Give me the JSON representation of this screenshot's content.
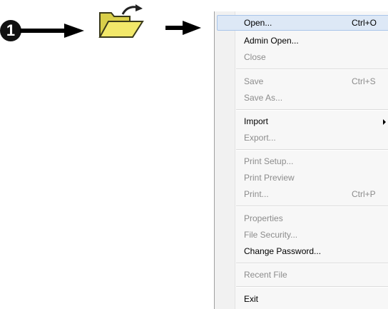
{
  "step": {
    "number": "1"
  },
  "icons": {
    "folder": "open-folder-icon",
    "arrow": "right-arrow-icon"
  },
  "menu": {
    "items": [
      {
        "label": "Open...",
        "shortcut": "Ctrl+O",
        "enabled": true,
        "selected": true
      },
      {
        "label": "Admin Open...",
        "shortcut": "",
        "enabled": true
      },
      {
        "label": "Close",
        "shortcut": "",
        "enabled": false
      },
      {
        "label": "Save",
        "shortcut": "Ctrl+S",
        "enabled": false
      },
      {
        "label": "Save As...",
        "shortcut": "",
        "enabled": false
      },
      {
        "label": "Import",
        "shortcut": "",
        "enabled": true,
        "submenu": true
      },
      {
        "label": "Export...",
        "shortcut": "",
        "enabled": false
      },
      {
        "label": "Print Setup...",
        "shortcut": "",
        "enabled": false
      },
      {
        "label": "Print Preview",
        "shortcut": "",
        "enabled": false
      },
      {
        "label": "Print...",
        "shortcut": "Ctrl+P",
        "enabled": false
      },
      {
        "label": "Properties",
        "shortcut": "",
        "enabled": false
      },
      {
        "label": "File Security...",
        "shortcut": "",
        "enabled": false
      },
      {
        "label": "Change Password...",
        "shortcut": "",
        "enabled": true
      },
      {
        "label": "Recent File",
        "shortcut": "",
        "enabled": false
      },
      {
        "label": "Exit",
        "shortcut": "",
        "enabled": true
      }
    ]
  },
  "colors": {
    "selection_bg": "#dde8f6",
    "selection_border": "#a9c5ea",
    "disabled_text": "#8c8c8c",
    "folder_yellow": "#f2e86a"
  }
}
